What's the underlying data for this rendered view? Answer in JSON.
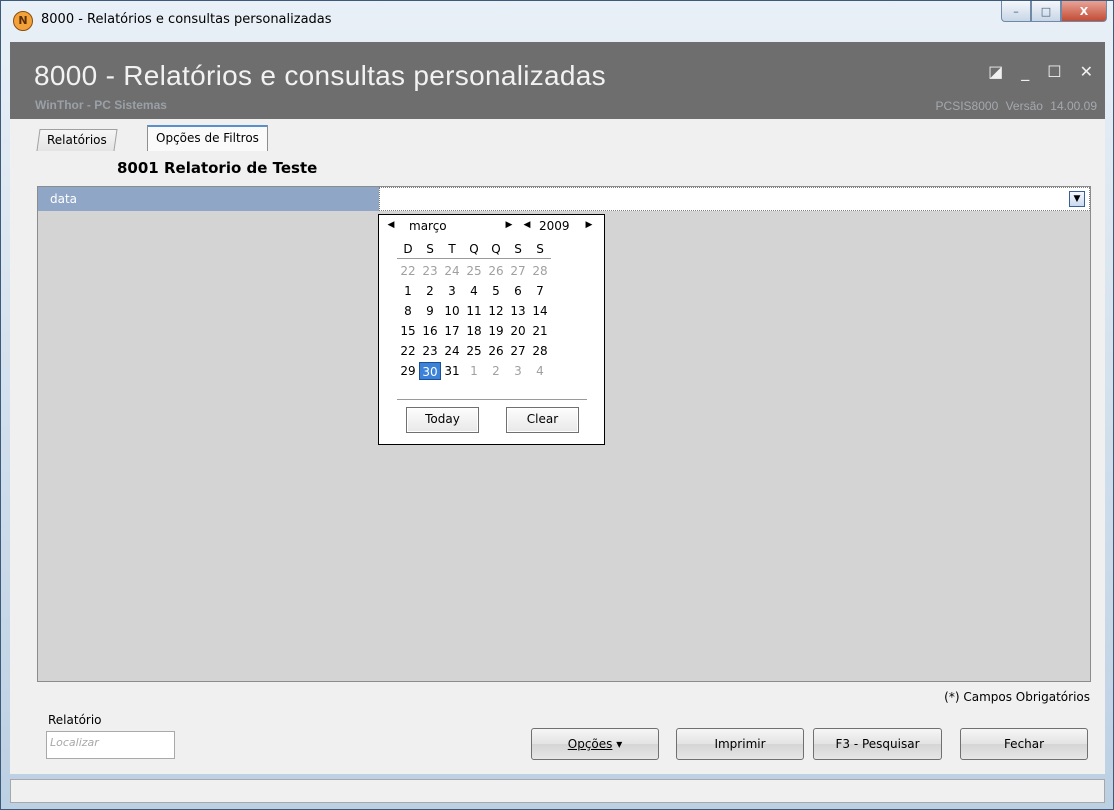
{
  "window": {
    "title": "8000 - Relatórios e consultas personalizadas",
    "logo_glyph": "N",
    "controls": {
      "minimize": "–",
      "maximize": "□",
      "close": "X"
    }
  },
  "header": {
    "title": "8000 - Relatórios e consultas personalizadas",
    "subtitle": "WinThor - PC Sistemas",
    "version": "PCSIS8000  Versão 14.00.09",
    "icons": {
      "restore": "◪",
      "minimize": "_",
      "maximize": "☐",
      "close": "✕"
    }
  },
  "tabs": [
    {
      "label": "Relatórios",
      "active": false
    },
    {
      "label": "Opções de Filtros",
      "active": true
    }
  ],
  "report": {
    "title": "8001 Relatorio de Teste"
  },
  "filter": {
    "label": "data",
    "value": ""
  },
  "calendar": {
    "month": "março",
    "year": "2009",
    "weekdays": [
      "D",
      "S",
      "T",
      "Q",
      "Q",
      "S",
      "S"
    ],
    "weeks": [
      [
        "22",
        "23",
        "24",
        "25",
        "26",
        "27",
        "28"
      ],
      [
        "1",
        "2",
        "3",
        "4",
        "5",
        "6",
        "7"
      ],
      [
        "8",
        "9",
        "10",
        "11",
        "12",
        "13",
        "14"
      ],
      [
        "15",
        "16",
        "17",
        "18",
        "19",
        "20",
        "21"
      ],
      [
        "22",
        "23",
        "24",
        "25",
        "26",
        "27",
        "28"
      ],
      [
        "29",
        "30",
        "31",
        "1",
        "2",
        "3",
        "4"
      ]
    ],
    "selected_day": "30",
    "today_label": "Today",
    "clear_label": "Clear"
  },
  "footer": {
    "required_note": "(*) Campos Obrigatórios",
    "report_label": "Relatório",
    "search_placeholder": "Localizar",
    "buttons": {
      "opcoes": "Opções",
      "imprimir": "Imprimir",
      "pesquisar_prefix": "F3 - ",
      "pesquisar": "Pesquisar",
      "fechar": "Fechar"
    }
  }
}
